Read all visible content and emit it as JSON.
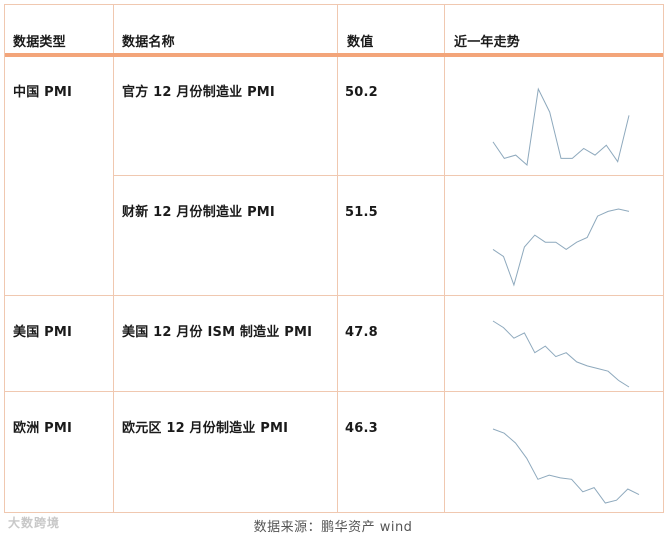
{
  "headers": {
    "category": "数据类型",
    "name": "数据名称",
    "value": "数值",
    "trend": "近一年走势"
  },
  "rows": [
    {
      "category": "中国 PMI",
      "name": "官方 12 月份制造业 PMI",
      "value": "50.2"
    },
    {
      "category": "",
      "name": "财新 12 月份制造业 PMI",
      "value": "51.5"
    },
    {
      "category": "美国 PMI",
      "name": "美国 12 月份 ISM 制造业 PMI",
      "value": "47.8"
    },
    {
      "category": "欧洲 PMI",
      "name": "欧元区 12 月份制造业 PMI",
      "value": "46.3"
    }
  ],
  "chart_data": [
    {
      "type": "line",
      "series": [
        {
          "values": [
            49.4,
            48.9,
            49.0,
            48.7,
            51.0,
            50.3,
            48.9,
            48.9,
            49.2,
            49.0,
            49.3,
            48.8,
            50.2
          ]
        }
      ]
    },
    {
      "type": "line",
      "series": [
        {
          "values": [
            49.9,
            49.6,
            48.4,
            50.0,
            50.5,
            50.2,
            50.2,
            49.9,
            50.2,
            50.4,
            51.3,
            51.5,
            51.6,
            51.5
          ]
        }
      ]
    },
    {
      "type": "line",
      "series": [
        {
          "values": [
            56.5,
            56.0,
            55.2,
            55.6,
            54.1,
            54.6,
            53.8,
            54.1,
            53.4,
            53.1,
            52.9,
            52.7,
            52.0,
            51.5
          ]
        }
      ]
    },
    {
      "type": "line",
      "series": [
        {
          "values": [
            50.6,
            50.3,
            49.6,
            48.5,
            47.0,
            47.3,
            47.1,
            47.0,
            46.1,
            46.4,
            45.3,
            45.5,
            46.3,
            45.9
          ]
        }
      ]
    }
  ],
  "footer": {
    "source": "数据来源：鹏华资产   wind",
    "watermark": "大数跨境"
  },
  "colors": {
    "border": "#f0c8b0",
    "header_bar": "#f3a57a",
    "sparkline": "#8ea9bd"
  }
}
